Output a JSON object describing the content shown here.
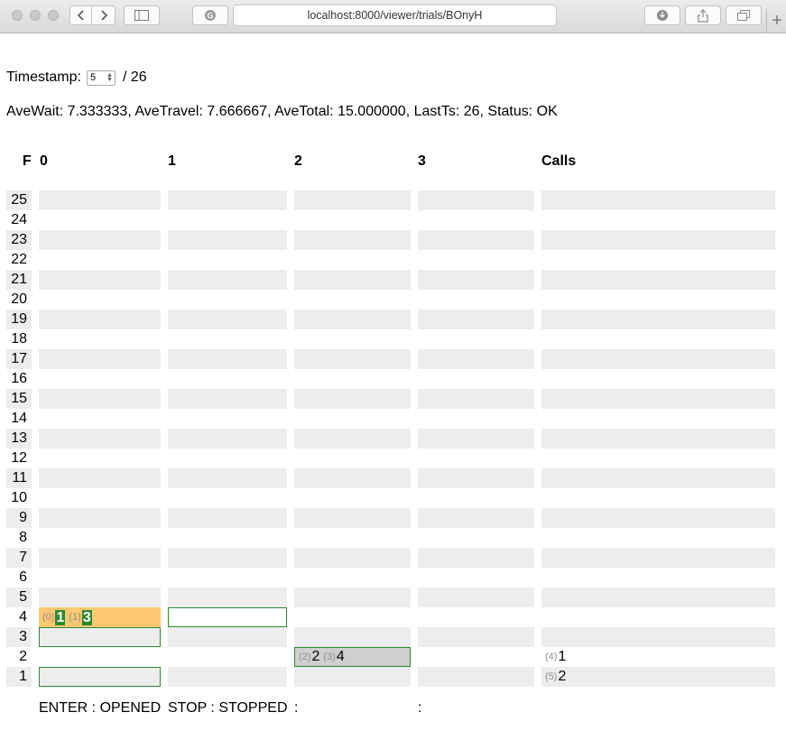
{
  "browser": {
    "url": "localhost:8000/viewer/trials/BOnyH",
    "icons": [
      "back-icon",
      "forward-icon",
      "sidebar-icon",
      "google-icon",
      "download-icon",
      "share-icon",
      "tabs-icon",
      "new-tab-icon"
    ]
  },
  "timestamp": {
    "label": "Timestamp:",
    "value": "5",
    "total": "/ 26"
  },
  "stats": "AveWait: 7.333333, AveTravel: 7.666667, AveTotal: 15.000000, LastTs: 26, Status: OK",
  "headers": {
    "floor": "F",
    "elevators": [
      "0",
      "1",
      "2",
      "3"
    ],
    "calls": "Calls"
  },
  "floors": [
    "25",
    "24",
    "23",
    "22",
    "21",
    "20",
    "19",
    "18",
    "17",
    "16",
    "15",
    "14",
    "13",
    "12",
    "11",
    "10",
    "9",
    "8",
    "7",
    "6",
    "5",
    "4",
    "3",
    "2",
    "1"
  ],
  "elevators": [
    {
      "floor": "4",
      "state": "open",
      "passengers": [
        {
          "idx": "(0)",
          "dest": "1"
        },
        {
          "idx": "(1)",
          "dest": "3"
        }
      ]
    },
    {
      "floor": "4",
      "state": "idle",
      "passengers": []
    },
    {
      "floor": "2",
      "state": "moving",
      "passengers": [
        {
          "idx": "(2)",
          "dest": "2"
        },
        {
          "idx": "(3)",
          "dest": "4"
        }
      ]
    }
  ],
  "targets": [
    {
      "elevator": 0,
      "floor": "3"
    },
    {
      "elevator": 0,
      "floor": "1"
    }
  ],
  "calls": [
    {
      "floor": "2",
      "idx": "(4)",
      "dest": "1"
    },
    {
      "floor": "1",
      "idx": "(5)",
      "dest": "2"
    }
  ],
  "legend": [
    "ENTER : OPENED",
    "STOP : STOPPED",
    ":",
    ":"
  ],
  "colors": {
    "stripe": "#ededed",
    "open": "#fdc872",
    "border": "#2e8b2e",
    "moving": "#cfcfcf",
    "badge": "#2e8a2e"
  }
}
